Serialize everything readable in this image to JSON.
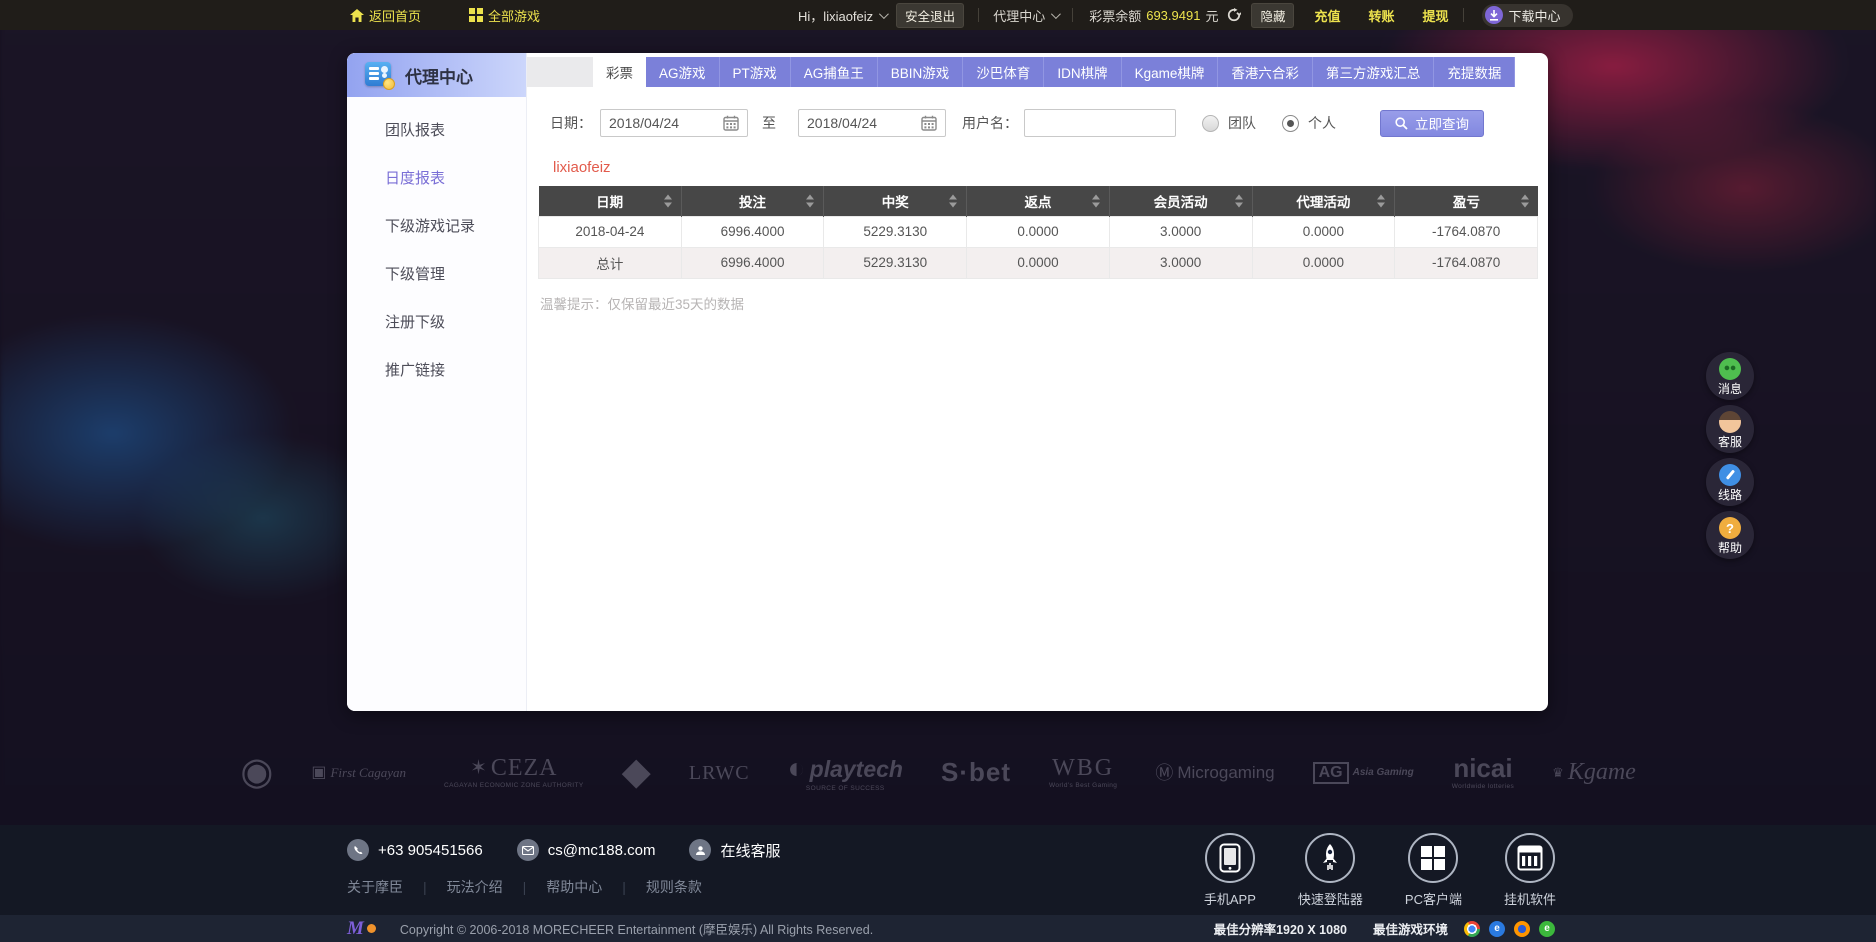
{
  "topbar": {
    "home": "返回首页",
    "all_games": "全部游戏",
    "greeting": "Hi，lixiaofeiz",
    "logout": "安全退出",
    "agent_center": "代理中心",
    "balance_label": "彩票余额",
    "balance_value": "693.9491",
    "balance_unit": "元",
    "hide": "隐藏",
    "deposit": "充值",
    "transfer": "转账",
    "withdraw": "提现",
    "download_center": "下载中心"
  },
  "sidebar": {
    "title": "代理中心",
    "items": [
      {
        "label": "团队报表",
        "active": false
      },
      {
        "label": "日度报表",
        "active": true
      },
      {
        "label": "下级游戏记录",
        "active": false
      },
      {
        "label": "下级管理",
        "active": false
      },
      {
        "label": "注册下级",
        "active": false
      },
      {
        "label": "推广链接",
        "active": false
      }
    ]
  },
  "tabs": [
    {
      "label": "彩票",
      "active": true
    },
    {
      "label": "AG游戏",
      "active": false
    },
    {
      "label": "PT游戏",
      "active": false
    },
    {
      "label": "AG捕鱼王",
      "active": false
    },
    {
      "label": "BBIN游戏",
      "active": false
    },
    {
      "label": "沙巴体育",
      "active": false
    },
    {
      "label": "IDN棋牌",
      "active": false
    },
    {
      "label": "Kgame棋牌",
      "active": false
    },
    {
      "label": "香港六合彩",
      "active": false
    },
    {
      "label": "第三方游戏汇总",
      "active": false
    },
    {
      "label": "充提数据",
      "active": false
    }
  ],
  "filter": {
    "date_label": "日期：",
    "date_from": "2018/04/24",
    "to_label": "至",
    "date_to": "2018/04/24",
    "username_label": "用户名：",
    "username_value": "",
    "radio_team": "团队",
    "team_selected": false,
    "radio_personal": "个人",
    "personal_selected": true,
    "search_button": "立即查询"
  },
  "report": {
    "username": "lixiaofeiz",
    "columns": [
      "日期",
      "投注",
      "中奖",
      "返点",
      "会员活动",
      "代理活动",
      "盈亏"
    ],
    "rows": [
      [
        "2018-04-24",
        "6996.4000",
        "5229.3130",
        "0.0000",
        "3.0000",
        "0.0000",
        "-1764.0870"
      ],
      [
        "总计",
        "6996.4000",
        "5229.3130",
        "0.0000",
        "3.0000",
        "0.0000",
        "-1764.0870"
      ]
    ],
    "note": "温馨提示：仅保留最近35天的数据"
  },
  "floating_buttons": [
    {
      "label": "消息",
      "icon": "message-icon",
      "cls": "msg"
    },
    {
      "label": "客服",
      "icon": "customer-service-icon",
      "cls": "svc"
    },
    {
      "label": "线路",
      "icon": "route-gauge-icon",
      "cls": "route"
    },
    {
      "label": "帮助",
      "icon": "help-icon",
      "cls": "help"
    }
  ],
  "footer": {
    "logos": [
      {
        "cls": "seal",
        "glyph": "◉",
        "text": "",
        "sub": ""
      },
      {
        "cls": "script",
        "glyph": "▣",
        "text": "First Cagayan",
        "sub": ""
      },
      {
        "cls": "ceza",
        "glyph": "✶",
        "text": "CEZA",
        "sub": "CAGAYAN ECONOMIC ZONE AUTHORITY"
      },
      {
        "cls": "crest",
        "glyph": "◆",
        "text": "",
        "sub": ""
      },
      {
        "cls": "serif",
        "glyph": "",
        "text": "LRWC",
        "sub": ""
      },
      {
        "cls": "playtech",
        "glyph": "◐",
        "text": "playtech",
        "sub": "SOURCE OF SUCCESS"
      },
      {
        "cls": "sbet",
        "glyph": "",
        "text": "S·bet",
        "sub": ""
      },
      {
        "cls": "wbg",
        "glyph": "",
        "text": "WBG",
        "sub": "World's Best Gaming"
      },
      {
        "cls": "micro",
        "glyph": "Ⓜ",
        "text": "Microgaming",
        "sub": ""
      },
      {
        "cls": "ag",
        "glyph": "AG",
        "text": "Asia Gaming",
        "sub": ""
      },
      {
        "cls": "nicai",
        "glyph": "",
        "text": "nicai",
        "sub": "Worldwide lotteries"
      },
      {
        "cls": "kgame",
        "glyph": "♛",
        "text": "Kgame",
        "sub": ""
      }
    ],
    "phone": "+63 905451566",
    "email": "cs@mc188.com",
    "online_service": "在线客服",
    "links": [
      "关于摩臣",
      "玩法介绍",
      "帮助中心",
      "规则条款"
    ],
    "apps": [
      {
        "label": "手机APP",
        "icon": "smartphone-icon"
      },
      {
        "label": "快速登陆器",
        "icon": "rocket-icon"
      },
      {
        "label": "PC客户端",
        "icon": "windows-icon"
      },
      {
        "label": "挂机软件",
        "icon": "software-icon"
      }
    ],
    "logo_letter": "M",
    "copyright": "Copyright © 2006-2018 MORECHEER Entertainment (摩臣娱乐) All Rights Reserved.",
    "resolution": "最佳分辨率1920 X 1080",
    "environment": "最佳游戏环境",
    "browsers": [
      {
        "name": "chrome",
        "letter": ""
      },
      {
        "name": "ie",
        "letter": "e"
      },
      {
        "name": "firefox",
        "letter": ""
      },
      {
        "name": "ie-green",
        "letter": "e"
      }
    ]
  },
  "icons": {
    "help_glyph": "?"
  }
}
